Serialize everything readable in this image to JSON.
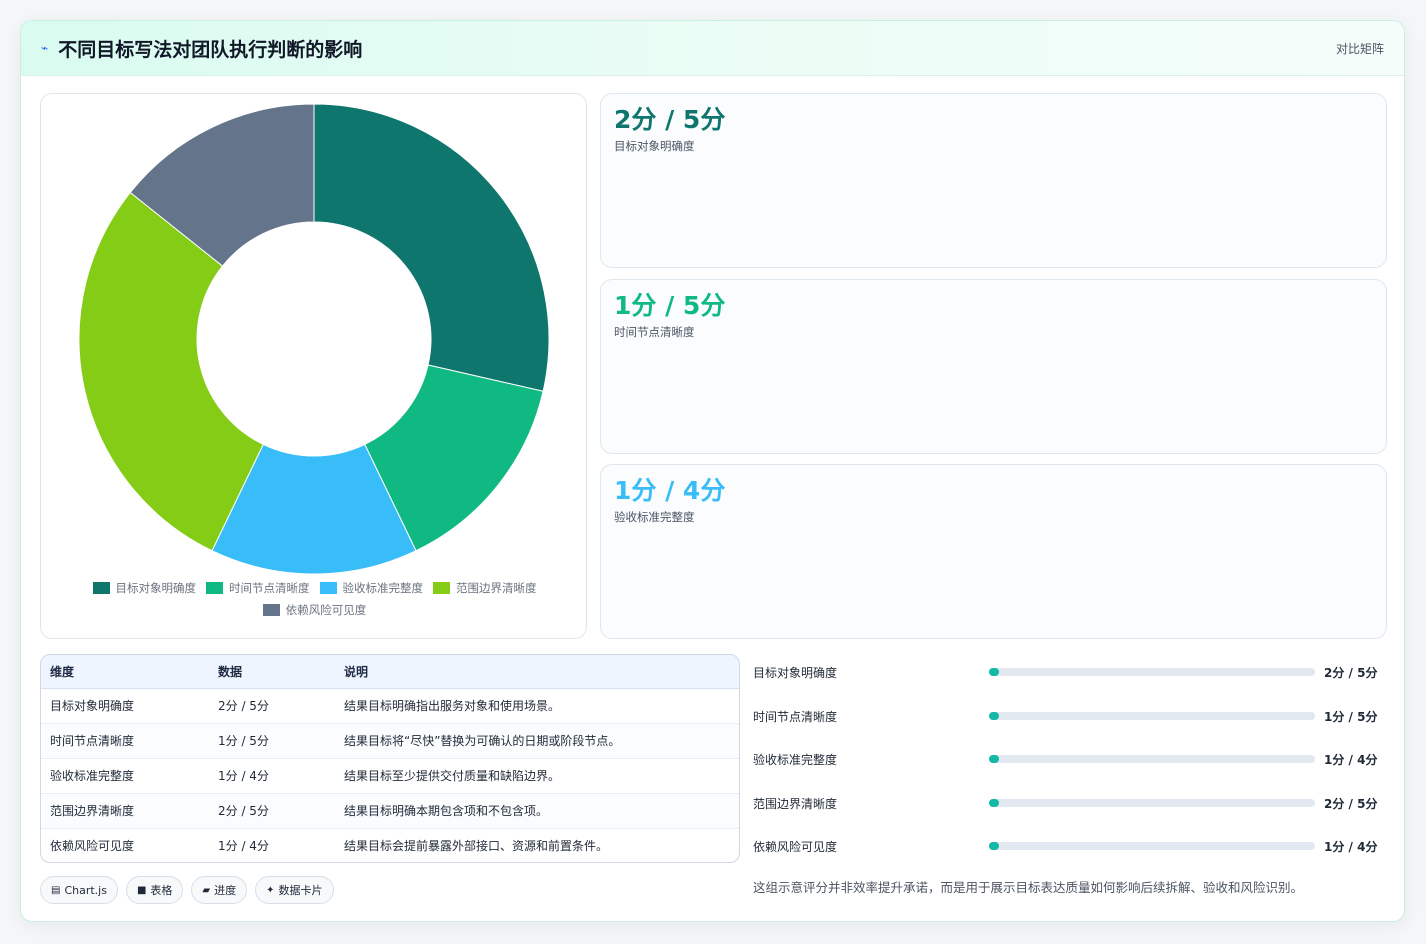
{
  "header": {
    "title": "不同目标写法对团队执行判断的影响",
    "right_label": "对比矩阵"
  },
  "chart_data": {
    "type": "pie",
    "variant": "doughnut",
    "categories": [
      "目标对象明确度",
      "时间节点清晰度",
      "验收标准完整度",
      "范围边界清晰度",
      "依赖风险可见度"
    ],
    "values": [
      2,
      1,
      1,
      2,
      1
    ],
    "colors": [
      "#0f766e",
      "#10b981",
      "#38bdf8",
      "#84cc16",
      "#64748b"
    ],
    "legend_position": "bottom"
  },
  "stats": [
    {
      "value": "2分 / 5分",
      "label": "目标对象明确度",
      "color": "#0f766e"
    },
    {
      "value": "1分 / 5分",
      "label": "时间节点清晰度",
      "color": "#10b981"
    },
    {
      "value": "1分 / 4分",
      "label": "验收标准完整度",
      "color": "#38bdf8"
    }
  ],
  "table": {
    "headers": [
      "维度",
      "数据",
      "说明"
    ],
    "rows": [
      [
        "目标对象明确度",
        "2分 / 5分",
        "结果目标明确指出服务对象和使用场景。"
      ],
      [
        "时间节点清晰度",
        "1分 / 5分",
        "结果目标将“尽快”替换为可确认的日期或阶段节点。"
      ],
      [
        "验收标准完整度",
        "1分 / 4分",
        "结果目标至少提供交付质量和缺陷边界。"
      ],
      [
        "范围边界清晰度",
        "2分 / 5分",
        "结果目标明确本期包含项和不包含项。"
      ],
      [
        "依赖风险可见度",
        "1分 / 4分",
        "结果目标会提前暴露外部接口、资源和前置条件。"
      ]
    ]
  },
  "progress": [
    {
      "label": "目标对象明确度",
      "value_text": "2分 / 5分",
      "fraction": 0.03
    },
    {
      "label": "时间节点清晰度",
      "value_text": "1分 / 5分",
      "fraction": 0.03
    },
    {
      "label": "验收标准完整度",
      "value_text": "1分 / 4分",
      "fraction": 0.03
    },
    {
      "label": "范围边界清晰度",
      "value_text": "2分 / 5分",
      "fraction": 0.03
    },
    {
      "label": "依赖风险可见度",
      "value_text": "1分 / 4分",
      "fraction": 0.03
    }
  ],
  "pills": [
    {
      "icon": "chart-icon",
      "glyph": "▤",
      "label": "Chart.js"
    },
    {
      "icon": "table-icon",
      "glyph": "■",
      "label": "表格"
    },
    {
      "icon": "progress-icon",
      "glyph": "▰",
      "label": "进度"
    },
    {
      "icon": "card-icon",
      "glyph": "✦",
      "label": "数据卡片"
    }
  ],
  "note": "这组示意评分并非效率提升承诺，而是用于展示目标表达质量如何影响后续拆解、验收和风险识别。"
}
